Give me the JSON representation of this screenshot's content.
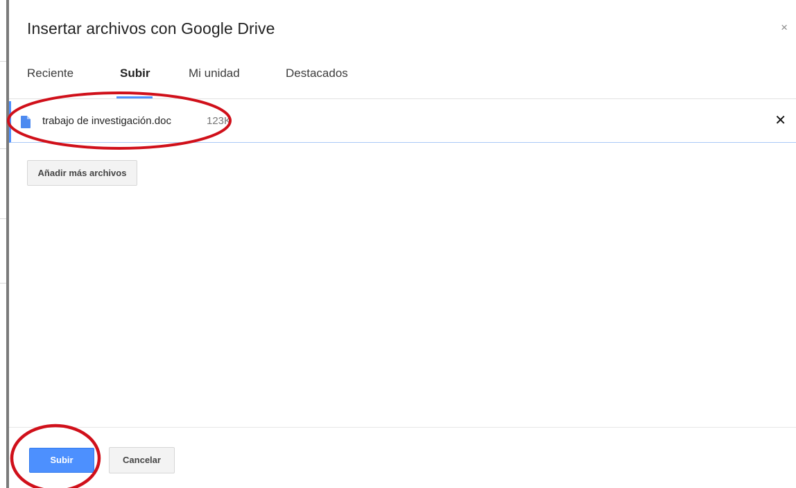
{
  "dialog": {
    "title": "Insertar archivos con Google Drive",
    "close_glyph": "×"
  },
  "tabs": [
    {
      "label": "Reciente",
      "active": false
    },
    {
      "label": "Subir",
      "active": true
    },
    {
      "label": "Mi unidad",
      "active": false
    },
    {
      "label": "Destacados",
      "active": false
    }
  ],
  "file": {
    "icon": "doc-icon",
    "name": "trabajo de investigación.doc",
    "size": "123K",
    "remove_glyph": "✕"
  },
  "actions": {
    "add_more_label": "Añadir más archivos",
    "upload_label": "Subir",
    "cancel_label": "Cancelar"
  },
  "colors": {
    "accent": "#4d90fe",
    "annotation": "#d0101a"
  }
}
